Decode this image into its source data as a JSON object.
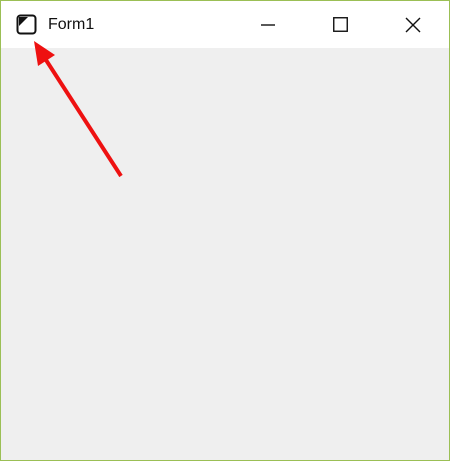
{
  "window": {
    "title": "Form1",
    "border_color": "#9bbf55",
    "client_background": "#efefef",
    "titlebar_background": "#ffffff"
  },
  "titlebar": {
    "icon": "form-window-icon",
    "controls": [
      "minimize-icon",
      "maximize-icon",
      "close-icon"
    ]
  },
  "annotation": {
    "type": "arrow",
    "color": "#ee1111",
    "target": "form-window-icon"
  }
}
